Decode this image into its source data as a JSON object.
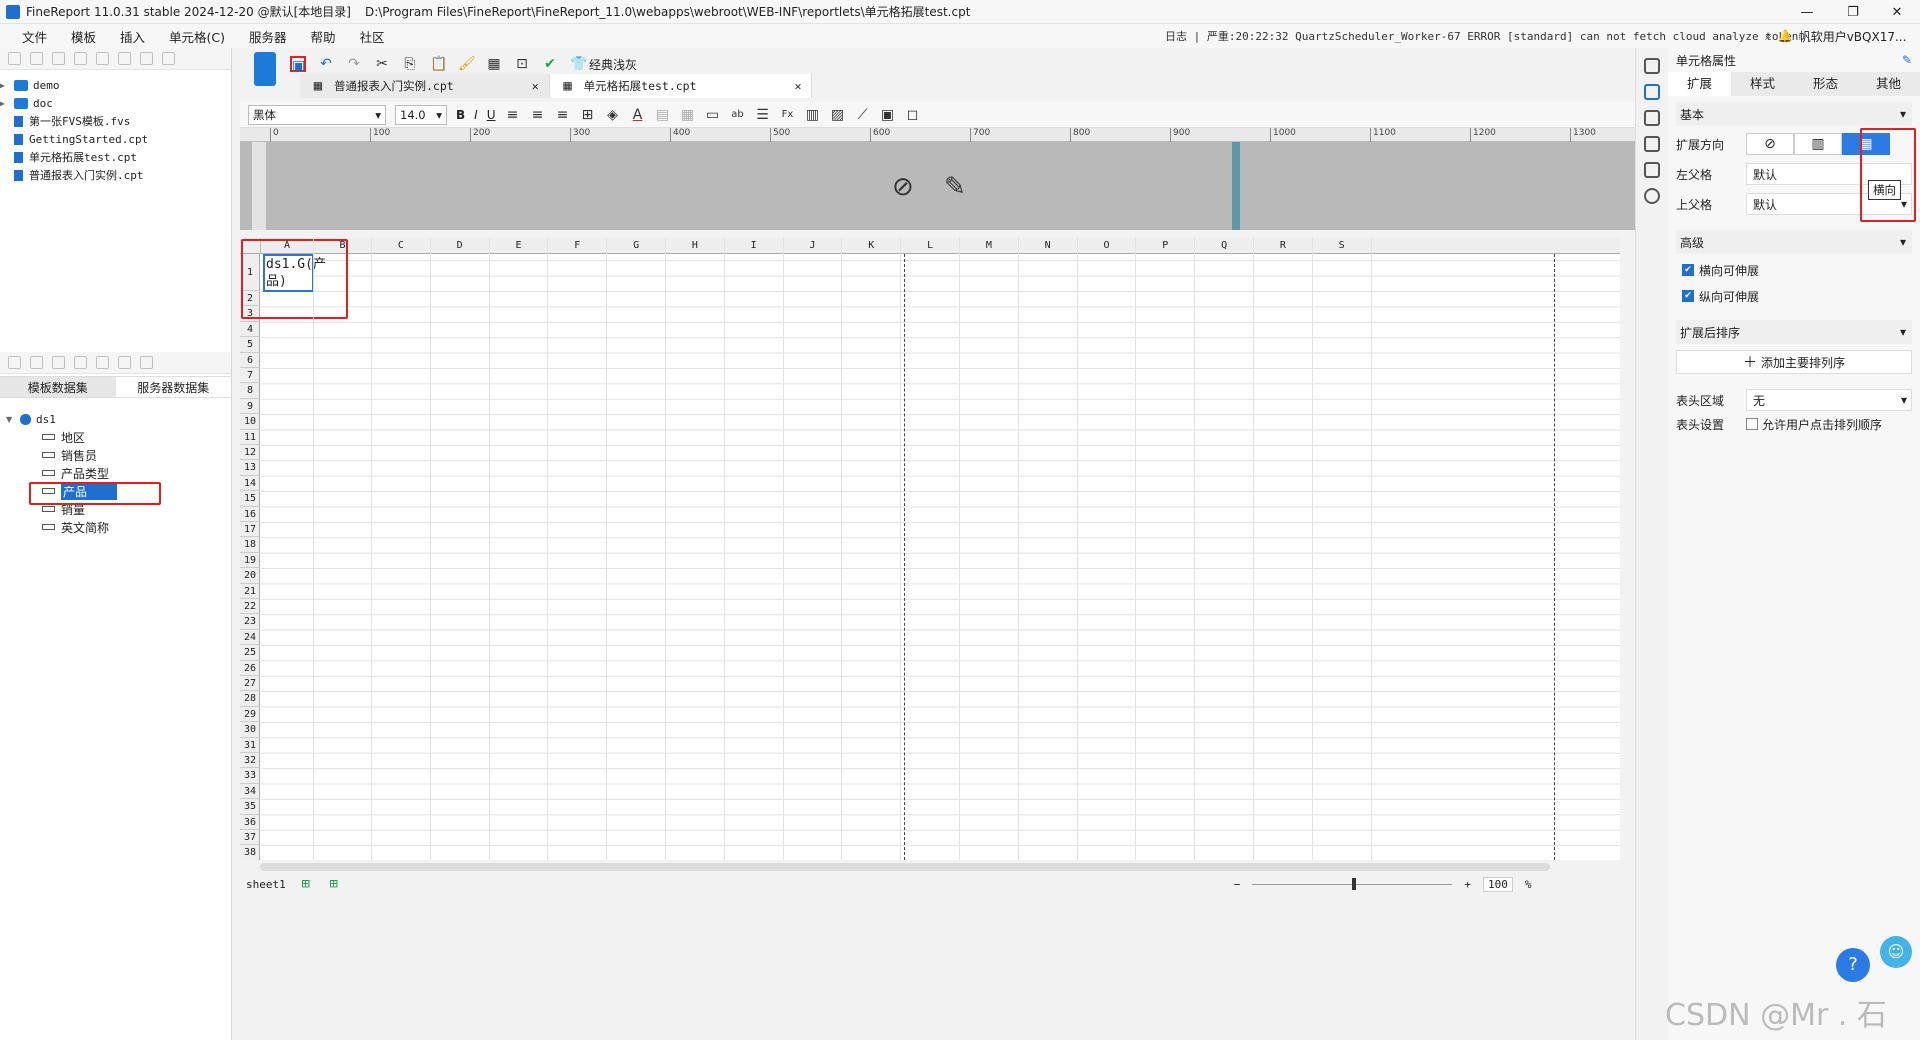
{
  "window": {
    "title": "FineReport 11.0.31 stable 2024-12-20 @默认[本地目录]",
    "path": "D:\\Program Files\\FineReport\\FineReport_11.0\\webapps\\webroot\\WEB-INF\\reportlets\\单元格拓展test.cpt",
    "minimize": "—",
    "maximize": "❐",
    "close": "✕"
  },
  "menu": [
    "文件",
    "模板",
    "插入",
    "单元格(C)",
    "服务器",
    "帮助",
    "社区"
  ],
  "log": {
    "label": "日志",
    "text": "严重:20:22:32 QuartzScheduler_Worker-67 ERROR [standard] can not fetch cloud analyze token."
  },
  "user": {
    "name": "帆软用户vBQX17..."
  },
  "filetree": [
    {
      "type": "folder",
      "name": "demo"
    },
    {
      "type": "folder",
      "name": "doc"
    },
    {
      "type": "file",
      "name": "第一张FVS模板.fvs"
    },
    {
      "type": "file",
      "name": "GettingStarted.cpt"
    },
    {
      "type": "file",
      "name": "单元格拓展test.cpt"
    },
    {
      "type": "file",
      "name": "普通报表入门实例.cpt"
    }
  ],
  "dataset_tabs": [
    "模板数据集",
    "服务器数据集"
  ],
  "dataset": {
    "name": "ds1",
    "columns": [
      "地区",
      "销售员",
      "产品类型",
      "产品",
      "销量",
      "英文简称"
    ],
    "selected": "产品"
  },
  "toolbar": {
    "theme_label": "经典浅灰"
  },
  "file_tabs": [
    "普通报表入门实例.cpt",
    "单元格拓展test.cpt"
  ],
  "format": {
    "font": "黑体",
    "size": "14.0",
    "bold": "B",
    "italic": "I",
    "underline": "U"
  },
  "ruler": [
    "0",
    "100",
    "200",
    "300",
    "400",
    "500",
    "600",
    "700",
    "800",
    "900",
    "1000",
    "1100",
    "1200",
    "1300"
  ],
  "columns": [
    "A",
    "B",
    "C",
    "D",
    "E",
    "F",
    "G",
    "H",
    "I",
    "J",
    "K",
    "L",
    "M",
    "N",
    "O",
    "P",
    "Q",
    "R",
    "S"
  ],
  "rows": [
    "1",
    "2",
    "3",
    "4",
    "5",
    "6",
    "7",
    "8",
    "9",
    "10",
    "11",
    "12",
    "13",
    "14",
    "15",
    "16",
    "17",
    "18",
    "19",
    "20",
    "21",
    "22",
    "23",
    "24",
    "25",
    "26",
    "27",
    "28",
    "29",
    "30",
    "31",
    "32",
    "33",
    "34",
    "35",
    "36",
    "37",
    "38"
  ],
  "cell_a1": "ds1.G(产品)",
  "sheet": {
    "name": "sheet1",
    "zoom": "100",
    "percent": "%"
  },
  "props": {
    "title": "单元格属性",
    "tabs": [
      "扩展",
      "样式",
      "形态",
      "其他"
    ],
    "basic": "基本",
    "direction_label": "扩展方向",
    "tooltip": "横向",
    "left_parent_label": "左父格",
    "left_parent": "默认",
    "up_parent_label": "上父格",
    "up_parent": "默认",
    "advanced": "高级",
    "h_expand": "横向可伸展",
    "v_expand": "纵向可伸展",
    "sort_section": "扩展后排序",
    "add_sort": "添加主要排列序",
    "header_area_label": "表头区域",
    "header_area": "无",
    "header_setting_label": "表头设置",
    "header_setting": "允许用户点击排列顺序"
  },
  "watermark": "CSDN @Mr . 石"
}
